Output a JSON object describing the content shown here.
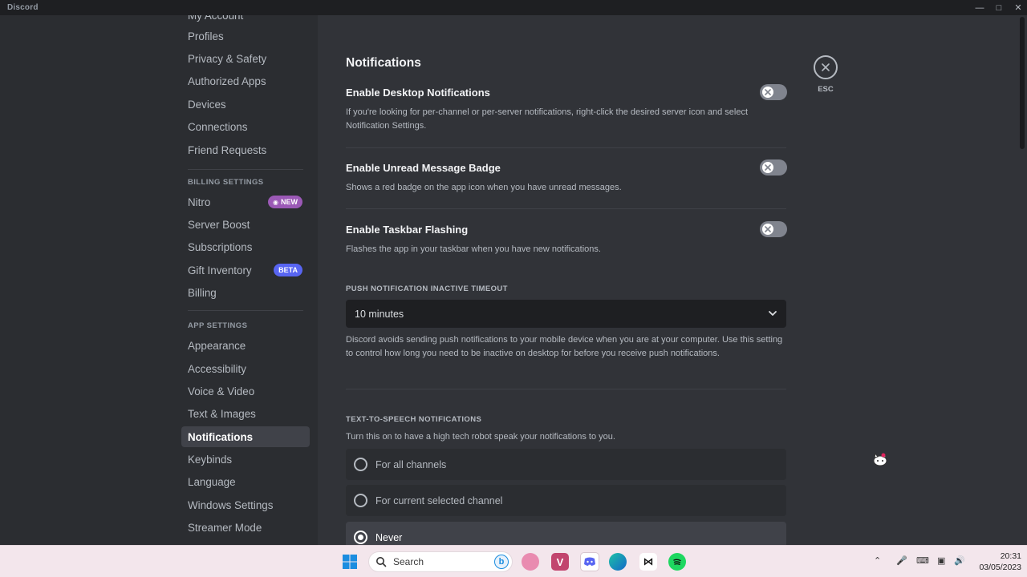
{
  "window": {
    "title": "Discord"
  },
  "sidebar": {
    "user_items": [
      "My Account",
      "Profiles",
      "Privacy & Safety",
      "Authorized Apps",
      "Devices",
      "Connections",
      "Friend Requests"
    ],
    "billing_header": "BILLING SETTINGS",
    "billing_items": [
      {
        "label": "Nitro",
        "badge": "NEW"
      },
      {
        "label": "Server Boost"
      },
      {
        "label": "Subscriptions"
      },
      {
        "label": "Gift Inventory",
        "badge": "BETA"
      },
      {
        "label": "Billing"
      }
    ],
    "app_header": "APP SETTINGS",
    "app_items": [
      "Appearance",
      "Accessibility",
      "Voice & Video",
      "Text & Images",
      "Notifications",
      "Keybinds",
      "Language",
      "Windows Settings",
      "Streamer Mode"
    ],
    "active_item": "Notifications"
  },
  "main": {
    "title": "Notifications",
    "esc_label": "ESC",
    "settings": [
      {
        "title": "Enable Desktop Notifications",
        "desc": "If you're looking for per-channel or per-server notifications, right-click the desired server icon and select Notification Settings.",
        "enabled": false
      },
      {
        "title": "Enable Unread Message Badge",
        "desc": "Shows a red badge on the app icon when you have unread messages.",
        "enabled": false
      },
      {
        "title": "Enable Taskbar Flashing",
        "desc": "Flashes the app in your taskbar when you have new notifications.",
        "enabled": false
      }
    ],
    "push_timeout": {
      "label": "PUSH NOTIFICATION INACTIVE TIMEOUT",
      "value": "10 minutes",
      "desc": "Discord avoids sending push notifications to your mobile device when you are at your computer. Use this setting to control how long you need to be inactive on desktop for before you receive push notifications."
    },
    "tts": {
      "label": "TEXT-TO-SPEECH NOTIFICATIONS",
      "desc": "Turn this on to have a high tech robot speak your notifications to you.",
      "options": [
        "For all channels",
        "For current selected channel",
        "Never"
      ],
      "selected": "Never"
    }
  },
  "taskbar": {
    "search_placeholder": "Search",
    "time": "20:31",
    "date": "03/05/2023",
    "icons": [
      "windows-start-icon",
      "search-icon",
      "bing-icon",
      "app-icon",
      "vivaldi-icon",
      "discord-icon",
      "edge-icon",
      "capcut-icon",
      "spotify-icon"
    ]
  },
  "colors": {
    "accent": "#5865f2",
    "nitro": "#9b59b6",
    "background": "#313338",
    "sidebar": "#2b2d31"
  }
}
